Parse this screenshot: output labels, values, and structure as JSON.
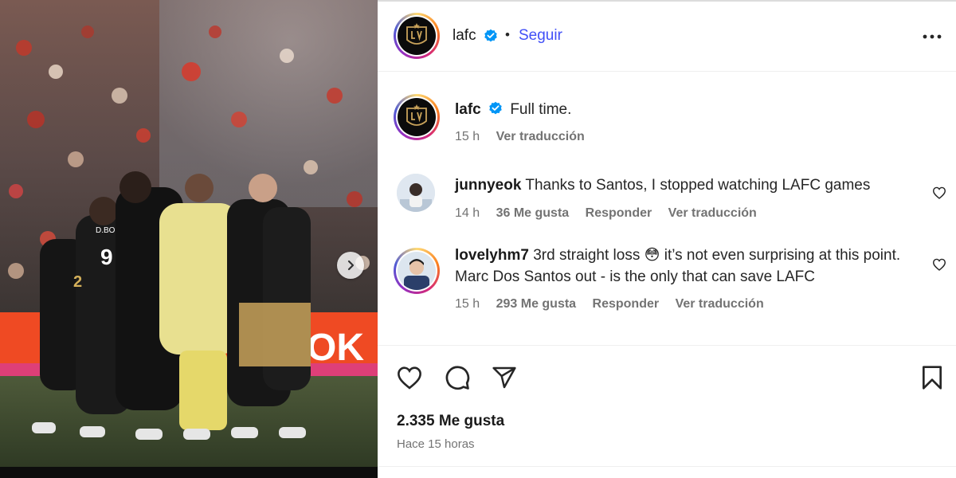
{
  "post": {
    "author": "lafc",
    "follow_label": "Seguir",
    "separator": "•",
    "logo_text": "LAFC"
  },
  "comments": [
    {
      "username": "lafc",
      "text": "Full time.",
      "time": "15 h",
      "translate": "Ver traducción",
      "is_caption": true
    },
    {
      "username": "junnyeok",
      "text": "Thanks to Santos, I stopped watching LAFC games",
      "time": "14 h",
      "likes": "36 Me gusta",
      "reply": "Responder",
      "translate": "Ver traducción"
    },
    {
      "username": "lovelyhm7",
      "text_line1": "3rd straight loss",
      "emoji": "😳",
      "text_line1_tail": "it’s not even surprising at this",
      "text_line2": "point. Marc Dos Santos out - is the only that can save LAFC",
      "time": "15 h",
      "likes": "293 Me gusta",
      "reply": "Responder",
      "translate": "Ver traducción"
    }
  ],
  "actions": {
    "like_count": "2.335 Me gusta",
    "posted_ago": "Hace 15 horas"
  },
  "photo": {
    "banner_text": "OK",
    "jersey_a": "D.BO",
    "jersey_a_num": "9",
    "jersey_b_num": "2"
  },
  "colors": {
    "follow_blue": "#4150f7",
    "verified_blue": "#0095f6",
    "meta_gray": "#737373",
    "banner_orange": "#ef4a23"
  },
  "icons": [
    "more-icon",
    "heart-icon",
    "comment-icon",
    "share-icon",
    "bookmark-icon",
    "verified-icon",
    "chevron-right-icon"
  ]
}
